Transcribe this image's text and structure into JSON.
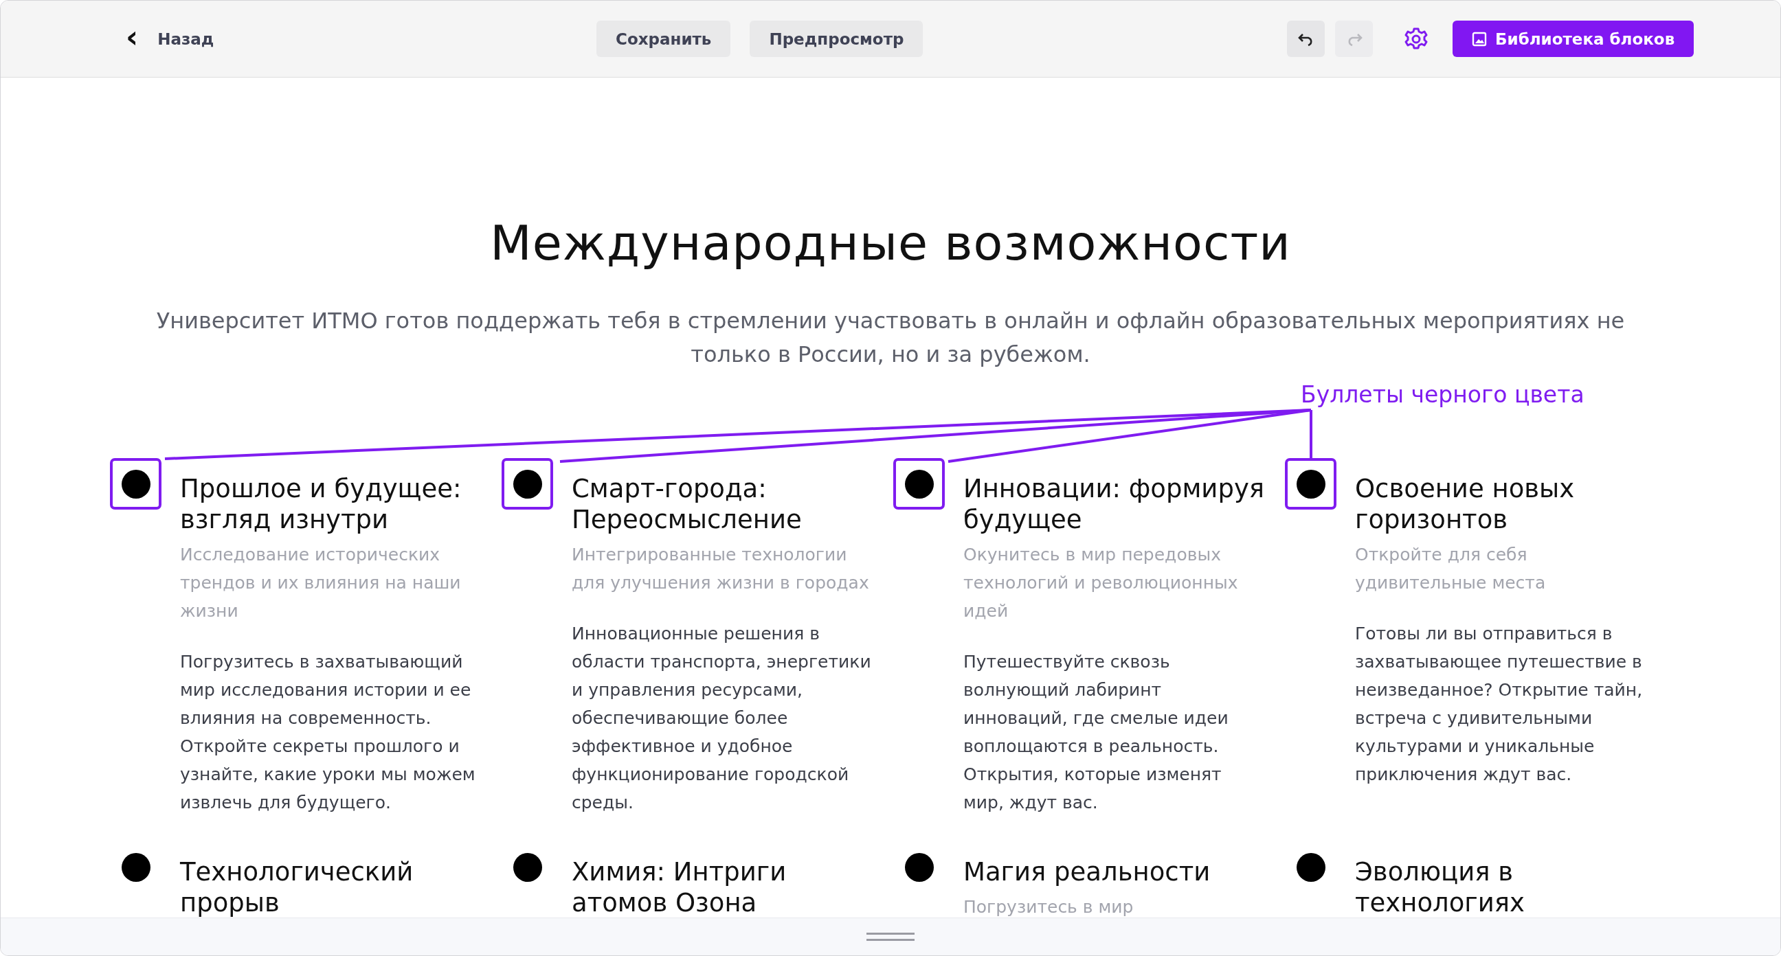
{
  "toolbar": {
    "back": {
      "icon": "‹",
      "label": "Назад"
    },
    "buttons": [
      "Сохранить",
      "Предпросмотр"
    ],
    "undo_disabled": false,
    "redo_disabled": true,
    "library_button": "Библиотека блоков"
  },
  "page": {
    "title": "Международные возможности",
    "subtitle": "Университет ИТМО готов поддержать тебя в стремлении участвовать в онлайн и офлайн образовательных мероприятиях не только в России, но и за рубежом.",
    "annotation": "Буллеты черного цвета",
    "items": [
      {
        "title": "Прошлое и будущее: взгляд изнутри",
        "description": "Исследование исторических трендов и их влияния на наши жизни",
        "body": "Погрузитесь в захватывающий мир исследования истории и ее влияния на современность. Откройте секреты прошлого и узнайте, какие уроки мы можем извлечь для будущего.",
        "highlighted": true
      },
      {
        "title": "Смарт-города: Переосмысление",
        "description": "Интегрированные технологии для улучшения жизни в городах",
        "body": "Инновационные решения в области транспорта, энергетики и управления ресурсами, обеспечивающие более эффективное и удобное функционирование городской среды.",
        "highlighted": true
      },
      {
        "title": "Инновации: формируя будущее",
        "description": "Окунитесь в мир передовых технологий и революционных идей",
        "body": "Путешествуйте сквозь волнующий лабиринт инноваций, где смелые идеи воплощаются в реальность. Открытия, которые изменят мир, ждут вас.",
        "highlighted": true
      },
      {
        "title": "Освоение новых горизонтов",
        "description": "Откройте для себя удивительные места",
        "body": "Готовы ли вы отправиться в захватывающее путешествие в неизведанное? Открытие тайн, встреча с удивительными культурами и уникальные приключения ждут вас.",
        "highlighted": true
      },
      {
        "title": "Технологический прорыв",
        "highlighted": false
      },
      {
        "title": "Химия: Интриги атомов Озона",
        "highlighted": false
      },
      {
        "title": "Магия реальности",
        "description": "Погрузитесь в мир",
        "highlighted": false
      },
      {
        "title": "Эволюция в технологиях",
        "highlighted": false
      }
    ]
  }
}
